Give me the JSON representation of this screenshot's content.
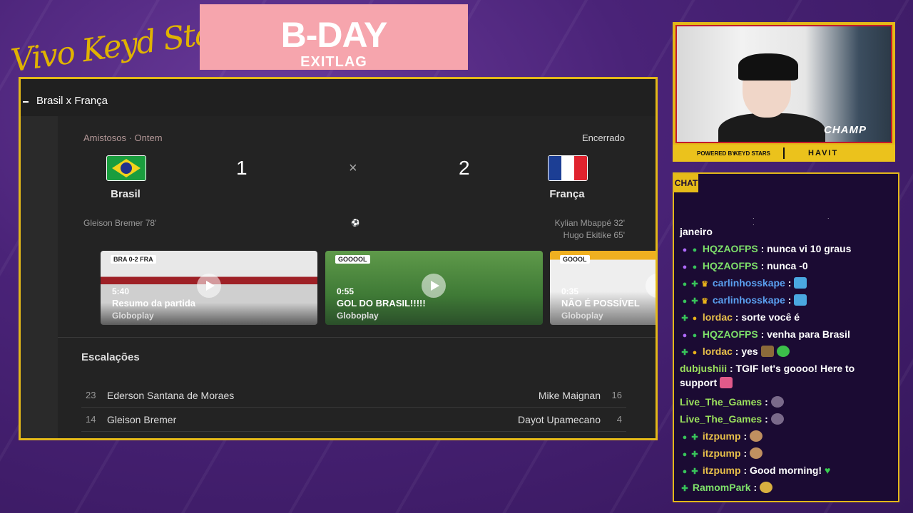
{
  "overlay": {
    "signature": "Vivo Keyd Stars",
    "banner_title": "B-DAY",
    "banner_sub": "EXITLAG"
  },
  "game": {
    "title": "Brasil x França",
    "competition": "Amistosos",
    "date": "Ontem",
    "status": "Encerrado",
    "home": {
      "name": "Brasil",
      "score": "1",
      "scorers": [
        "Gleison Bremer 78'"
      ]
    },
    "away": {
      "name": "França",
      "score": "2",
      "scorers": [
        "Kylian Mbappé 32'",
        "Hugo Ekitike 65'"
      ]
    },
    "vs": "×",
    "videos": [
      {
        "duration": "5:40",
        "caption": "Resumo da partida",
        "source": "Globoplay"
      },
      {
        "duration": "0:55",
        "caption": "GOL DO BRASIL!!!!!",
        "source": "Globoplay"
      },
      {
        "duration": "0:35",
        "caption": "NÃO É POSSÍVEL",
        "source": "Globoplay"
      }
    ],
    "lineups_title": "Escalações",
    "lineups": [
      {
        "home_num": "23",
        "home_name": "Ederson Santana de Moraes",
        "away_name": "Mike Maignan",
        "away_num": "16"
      },
      {
        "home_num": "14",
        "home_name": "Gleison Bremer",
        "away_name": "Dayot Upamecano",
        "away_num": "4"
      }
    ]
  },
  "webcam": {
    "overlay_text": "CHAMP",
    "powered_by": "POWERED BY",
    "sponsor1": "KEYD STARS",
    "sponsor2": "HAVIT"
  },
  "chat": {
    "tab_label": "CHAT",
    "messages": [
      {
        "user": "",
        "text": "janeiro"
      },
      {
        "user": "HQZAOFPS",
        "text": ": nunca vi 10 graus",
        "color": "#7ee06a"
      },
      {
        "user": "HQZAOFPS",
        "text": ": nunca -0",
        "color": "#7ee06a"
      },
      {
        "user": "carlinhosskape",
        "text": ":",
        "color": "#5aa0f0"
      },
      {
        "user": "carlinhosskape",
        "text": ":",
        "color": "#5aa0f0"
      },
      {
        "user": "lordac",
        "text": ": sorte você é",
        "color": "#e8c04a"
      },
      {
        "user": "HQZAOFPS",
        "text": ": venha para Brasil",
        "color": "#7ee06a"
      },
      {
        "user": "lordac",
        "text": ": yes",
        "color": "#e8c04a"
      },
      {
        "user": "dubjushiii",
        "text": ": TGIF let's goooo! Here to support",
        "color": "#9adf5c"
      },
      {
        "user": "Live_The_Games",
        "text": ":",
        "color": "#9adf5c"
      },
      {
        "user": "Live_The_Games",
        "text": ":",
        "color": "#9adf5c"
      },
      {
        "user": "itzpump",
        "text": ":",
        "color": "#e8c04a"
      },
      {
        "user": "itzpump",
        "text": ":",
        "color": "#e8c04a"
      },
      {
        "user": "itzpump",
        "text": ": Good morning!",
        "color": "#e8c04a"
      },
      {
        "user": "RamomPark",
        "text": ":",
        "color": "#7ee06a"
      }
    ]
  },
  "colors": {
    "accent": "#e3b819",
    "background": "#4a2378",
    "card": "#232323"
  }
}
